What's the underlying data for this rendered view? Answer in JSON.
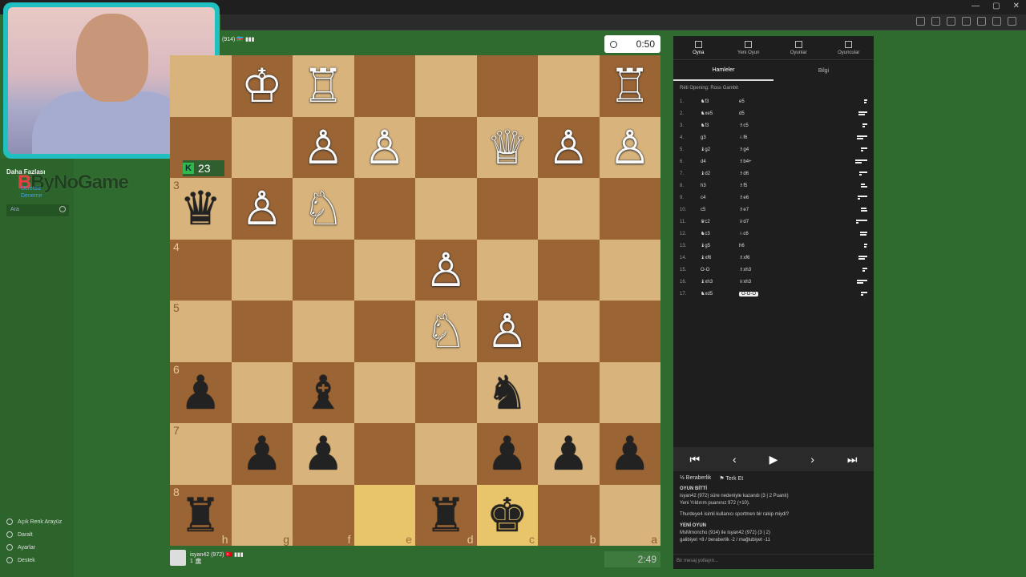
{
  "browser": {
    "window_controls": [
      "—",
      "▢",
      "✕"
    ]
  },
  "sidebar": {
    "more_label": "Daha Fazlası",
    "logo_prefix": "B",
    "logo_text": "ByNoGame",
    "trial_line1": "Ücretsiz",
    "trial_line2": "Deneme",
    "search_placeholder": "Ara",
    "menu": [
      {
        "label": "Açık Renk Arayüz"
      },
      {
        "label": "Daralt"
      },
      {
        "label": "Ayarlar"
      },
      {
        "label": "Destek"
      }
    ]
  },
  "game": {
    "opponent_info": "(914) 🇦🇿 ▮▮▮",
    "opponent_clock": "0:50",
    "captured_score": "23",
    "player_name": "isyan42",
    "player_info": "(972) 🇹🇷 ▮▮▮",
    "player_sub": "1 🏛",
    "player_clock": "2:49",
    "board": [
      [
        "",
        "♔",
        "♖",
        "",
        "",
        "",
        "",
        "♖"
      ],
      [
        "",
        "",
        "♙",
        "♙",
        "",
        "♕",
        "♙",
        "♙"
      ],
      [
        "♛",
        "♙",
        "♘",
        "",
        "",
        "",
        "",
        ""
      ],
      [
        "",
        "",
        "",
        "",
        "♙",
        "",
        "",
        ""
      ],
      [
        "",
        "",
        "",
        "",
        "♘",
        "♙",
        "",
        ""
      ],
      [
        "♟",
        "",
        "♝",
        "",
        "",
        "♞",
        "",
        ""
      ],
      [
        "",
        "♟",
        "♟",
        "",
        "",
        "♟",
        "♟",
        "♟"
      ],
      [
        "♜",
        "",
        "",
        "",
        "♜",
        "♚",
        "",
        ""
      ]
    ],
    "colors": [
      [
        "",
        "w",
        "w",
        "",
        "",
        "",
        "",
        "w"
      ],
      [
        "",
        "",
        "w",
        "w",
        "",
        "w",
        "w",
        "w"
      ],
      [
        "b",
        "w",
        "w",
        "",
        "",
        "",
        "",
        ""
      ],
      [
        "",
        "",
        "",
        "",
        "w",
        "",
        "",
        ""
      ],
      [
        "",
        "",
        "",
        "",
        "w",
        "w",
        "",
        ""
      ],
      [
        "b",
        "",
        "b",
        "",
        "",
        "b",
        "",
        ""
      ],
      [
        "",
        "b",
        "b",
        "",
        "",
        "b",
        "b",
        "b"
      ],
      [
        "b",
        "",
        "",
        "",
        "b",
        "b",
        "",
        ""
      ]
    ],
    "ranks": [
      "",
      "",
      "3",
      "4",
      "5",
      "6",
      "7",
      "8"
    ],
    "files": [
      "h",
      "g",
      "f",
      "e",
      "d",
      "c",
      "b",
      "a"
    ],
    "highlight": [
      [
        7,
        3
      ],
      [
        7,
        5
      ]
    ]
  },
  "panel": {
    "tabs": [
      {
        "label": "Oyna",
        "icon": "lightning-icon"
      },
      {
        "label": "Yeni Oyun",
        "icon": "plus-icon"
      },
      {
        "label": "Oyunlar",
        "icon": "board-icon"
      },
      {
        "label": "Oyuncular",
        "icon": "people-icon"
      }
    ],
    "subtabs": [
      "Hamleler",
      "Bilgi"
    ],
    "opening": "Réti Opening: Ross Gambit",
    "moves": [
      {
        "n": "1.",
        "w": "♞f3",
        "b": "e5"
      },
      {
        "n": "2.",
        "w": "♞xe5",
        "b": "d5"
      },
      {
        "n": "3.",
        "w": "♞f3",
        "b": "♗c5"
      },
      {
        "n": "4.",
        "w": "g3",
        "b": "♘f6"
      },
      {
        "n": "5.",
        "w": "♝g2",
        "b": "♗g4"
      },
      {
        "n": "6.",
        "w": "d4",
        "b": "♗b4+"
      },
      {
        "n": "7.",
        "w": "♝d2",
        "b": "♗d6"
      },
      {
        "n": "8.",
        "w": "h3",
        "b": "♗f5"
      },
      {
        "n": "9.",
        "w": "c4",
        "b": "♗e6"
      },
      {
        "n": "10.",
        "w": "c5",
        "b": "♗e7"
      },
      {
        "n": "11.",
        "w": "♛c2",
        "b": "♕d7"
      },
      {
        "n": "12.",
        "w": "♞c3",
        "b": "♘c6"
      },
      {
        "n": "13.",
        "w": "♝g5",
        "b": "h6"
      },
      {
        "n": "14.",
        "w": "♝xf6",
        "b": "♗xf6"
      },
      {
        "n": "15.",
        "w": "O-O",
        "b": "♗xh3"
      },
      {
        "n": "16.",
        "w": "♝xh3",
        "b": "♕xh3"
      },
      {
        "n": "17.",
        "w": "♞xd5",
        "b": "O-O-O"
      }
    ],
    "nav": [
      "⏮",
      "‹",
      "▶",
      "›",
      "⏭"
    ],
    "draw_label": "Beraberlik",
    "resign_label": "Terk Et",
    "chat_title1": "OYUN BİTTİ",
    "chat_line1": "isyan42 (972) süre nedeniyle kazandı (3 | 2 Puanlı)",
    "chat_line2": "Yeni Yıldırım puanınız 972 (+10).",
    "chat_line3": "Thurdeye4 isimli kullanıcı sportmen bir rakip miydi?",
    "chat_title2": "YENİ OYUN",
    "chat_line4": "MsMmoncho (914) ile isyan42 (972) (3 | 2)",
    "chat_line5": "galibiyet +8 / beraberlik -2 / mağlubiyet -11",
    "chat_placeholder": "Bir mesaj yollayın..."
  }
}
